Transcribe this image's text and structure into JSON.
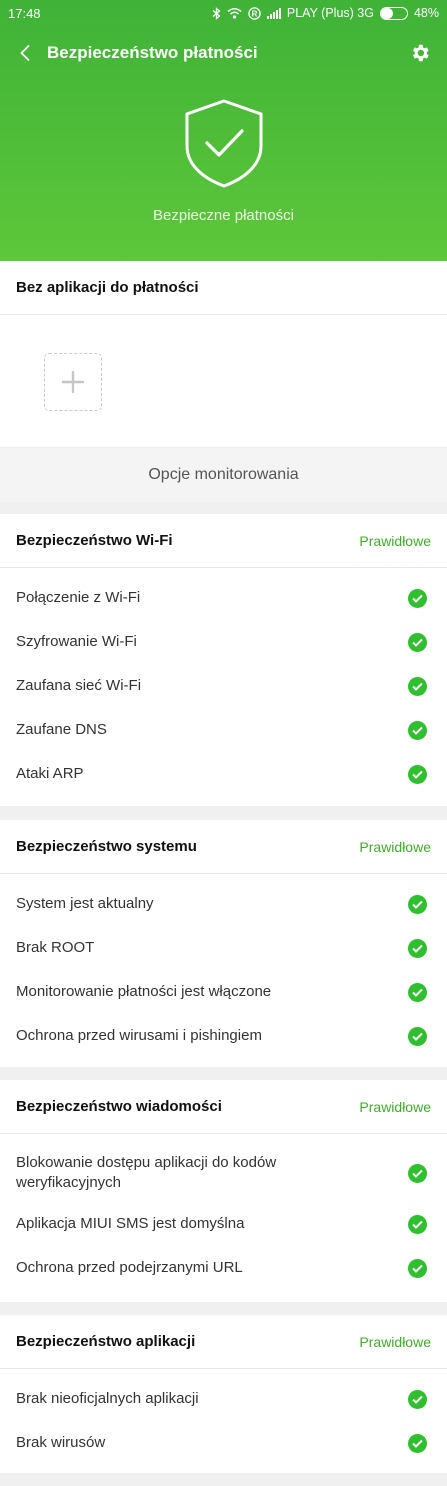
{
  "status_bar": {
    "time": "17:48",
    "roaming": "R",
    "carrier": "PLAY (Plus) 3G",
    "battery_percent": "48%",
    "battery_level": 0.48
  },
  "header": {
    "title": "Bezpieczeństwo płatności",
    "hero_label": "Bezpieczne płatności",
    "accent_color": "#4cbc36"
  },
  "payment_apps": {
    "title": "Bez aplikacji do płatności"
  },
  "monitoring_options_label": "Opcje monitorowania",
  "sections": [
    {
      "title": "Bezpieczeństwo Wi-Fi",
      "status": "Prawidłowe",
      "items": [
        "Połączenie z Wi-Fi",
        "Szyfrowanie Wi-Fi",
        "Zaufana sieć Wi-Fi",
        "Zaufane DNS",
        "Ataki ARP"
      ]
    },
    {
      "title": "Bezpieczeństwo systemu",
      "status": "Prawidłowe",
      "items": [
        "System jest aktualny",
        "Brak ROOT",
        "Monitorowanie płatności jest włączone",
        "Ochrona przed wirusami i pishingiem"
      ]
    },
    {
      "title": "Bezpieczeństwo wiadomości",
      "status": "Prawidłowe",
      "items": [
        "Blokowanie dostępu aplikacji do kodów weryfikacyjnych",
        "Aplikacja MIUI SMS jest domyślna",
        "Ochrona przed podejrzanymi URL"
      ]
    },
    {
      "title": "Bezpieczeństwo aplikacji",
      "status": "Prawidłowe",
      "items": [
        "Brak nieoficjalnych aplikacji",
        "Brak wirusów"
      ]
    }
  ]
}
